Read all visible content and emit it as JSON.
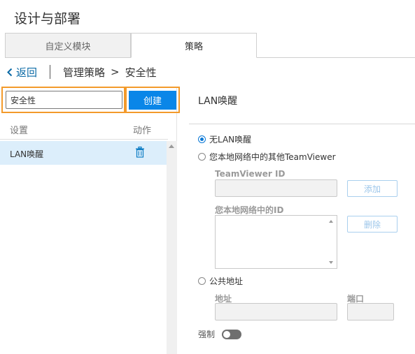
{
  "app": {
    "title": "设计与部署"
  },
  "tabs": [
    {
      "label": "自定义模块"
    },
    {
      "label": "策略"
    }
  ],
  "nav": {
    "back_label": "返回",
    "breadcrumb": [
      "管理策略",
      "安全性"
    ],
    "separator": ">"
  },
  "left": {
    "search_value": "安全性",
    "create_label": "创建",
    "columns": {
      "setting": "设置",
      "action": "动作"
    },
    "rows": [
      {
        "label": "LAN唤醒"
      }
    ]
  },
  "right": {
    "title": "LAN唤醒",
    "options": [
      {
        "label": "无LAN唤醒",
        "checked": true
      },
      {
        "label": "您本地网络中的其他TeamViewer",
        "checked": false
      },
      {
        "label": "公共地址",
        "checked": false
      }
    ],
    "teamviewer_id_label": "TeamViewer ID",
    "add_label": "添加",
    "local_ids_label": "您本地网络中的ID",
    "delete_label": "删除",
    "address_label": "地址",
    "port_label": "端口",
    "force_label": "强制"
  },
  "colors": {
    "accent": "#0a86e8",
    "highlight": "#f39a2b",
    "selected_row": "#dceefb"
  }
}
